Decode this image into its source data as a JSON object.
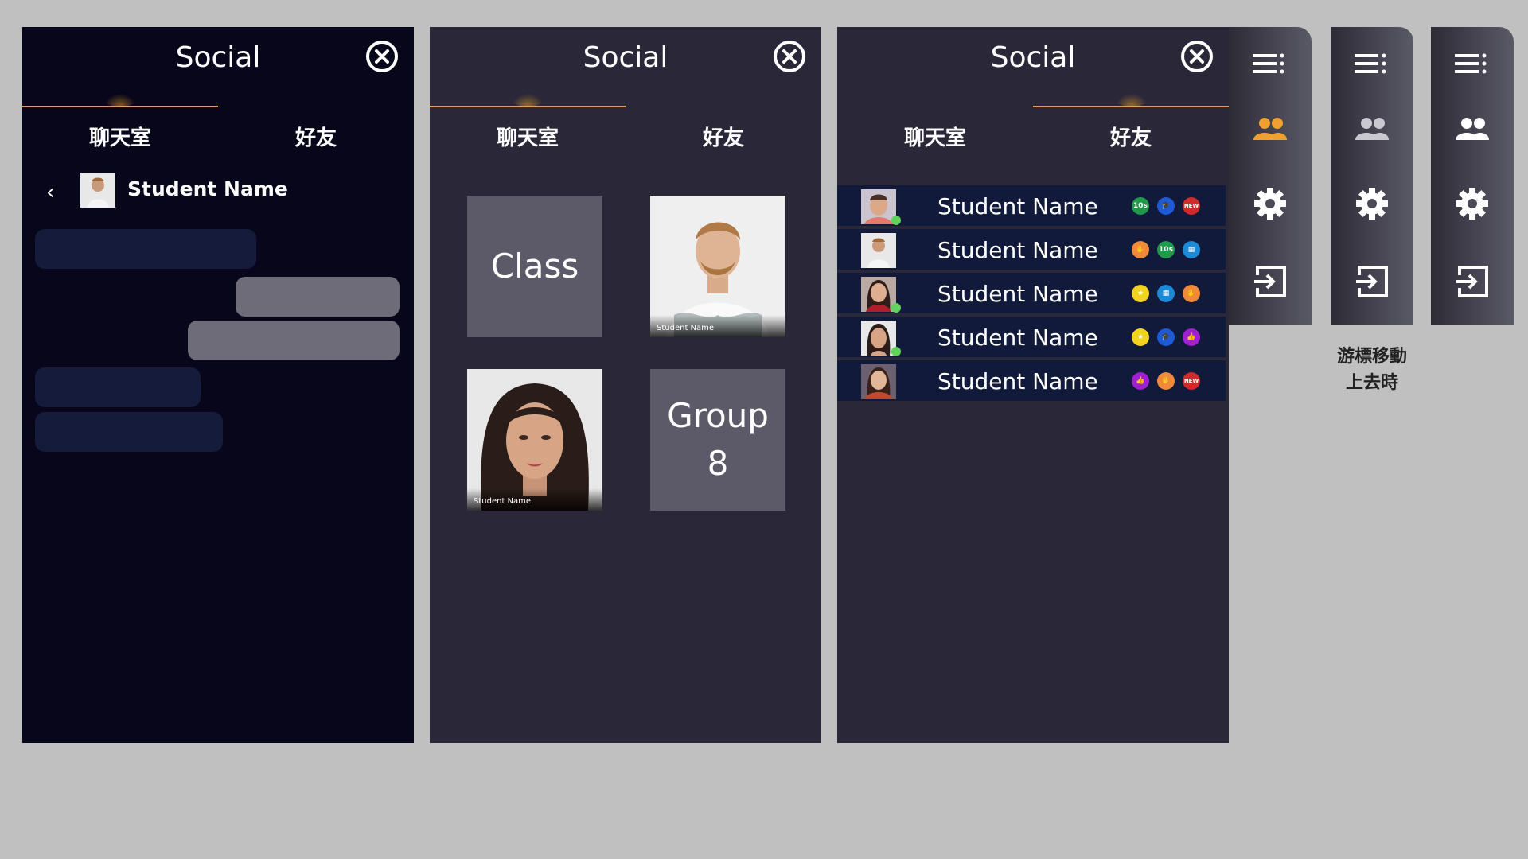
{
  "panels": {
    "chat": {
      "title": "Social",
      "tab_chat": "聊天室",
      "tab_friends": "好友",
      "back_icon": "‹",
      "contact_name": "Student Name"
    },
    "rooms": {
      "title": "Social",
      "tab_chat": "聊天室",
      "tab_friends": "好友",
      "tiles": [
        {
          "label": "Class"
        },
        {
          "caption": "Student Name"
        },
        {
          "caption": "Student Name"
        },
        {
          "label_line1": "Group",
          "label_line2": "8"
        }
      ]
    },
    "friends": {
      "title": "Social",
      "tab_chat": "聊天室",
      "tab_friends": "好友",
      "rows": [
        {
          "name": "Student Name",
          "online": true,
          "badges": [
            "10s-badge",
            "graduation-cap-badge",
            "new-badge"
          ]
        },
        {
          "name": "Student Name",
          "online": false,
          "badges": [
            "hand-badge",
            "10s-badge",
            "chart-badge"
          ]
        },
        {
          "name": "Student Name",
          "online": true,
          "badges": [
            "star-badge",
            "chart-badge",
            "hand-badge"
          ]
        },
        {
          "name": "Student Name",
          "online": true,
          "badges": [
            "star-badge",
            "graduation-cap-badge",
            "thumbs-up-badge"
          ]
        },
        {
          "name": "Student Name",
          "online": false,
          "badges": [
            "thumbs-up-badge",
            "hand-badge",
            "new-badge"
          ]
        }
      ],
      "badge_text": {
        "ten": "10s",
        "new": "NEW"
      }
    }
  },
  "sidebar": {
    "hover_caption_line1": "游標移動",
    "hover_caption_line2": "上去時",
    "active_color": "#f0a030",
    "icons": [
      "menu-icon",
      "friends-icon",
      "settings-icon",
      "logout-icon"
    ]
  },
  "colors": {
    "accent": "#f0a030",
    "online": "#5fd35c",
    "row_bg": "#121a3c"
  }
}
